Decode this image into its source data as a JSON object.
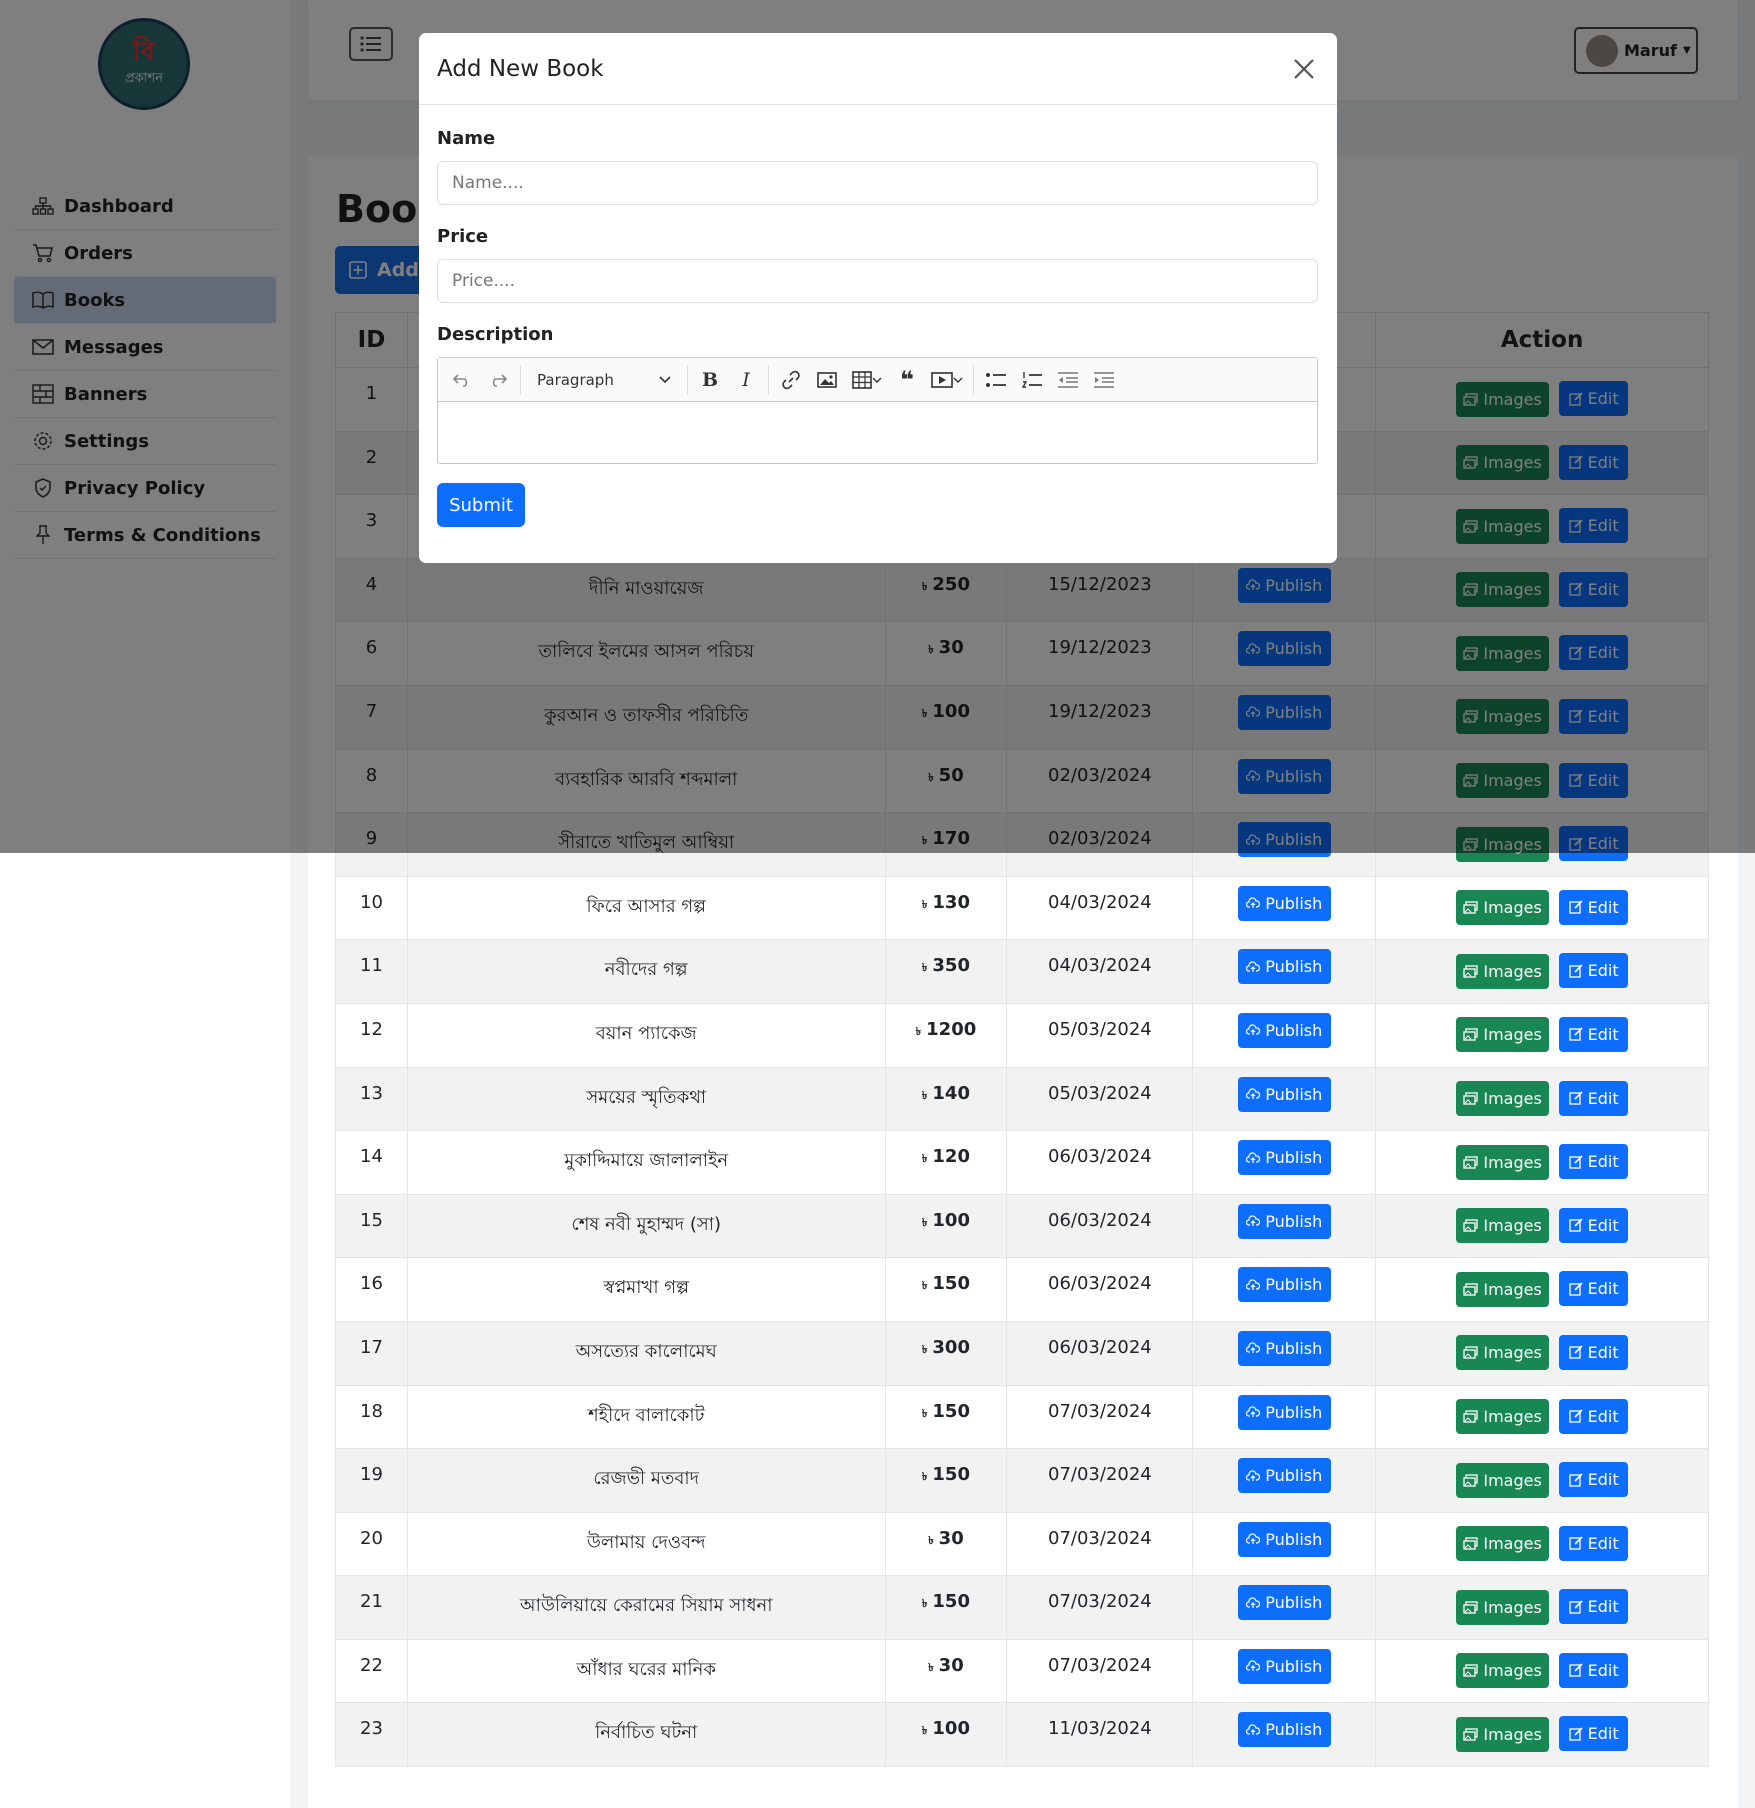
{
  "sidebar": {
    "logo_glyph": "বি",
    "logo_text": "প্রকাশন",
    "items": [
      {
        "label": "Dashboard",
        "icon": "sitemap-icon"
      },
      {
        "label": "Orders",
        "icon": "cart-icon"
      },
      {
        "label": "Books",
        "icon": "book-icon",
        "active": true
      },
      {
        "label": "Messages",
        "icon": "envelope-icon"
      },
      {
        "label": "Banners",
        "icon": "bricks-icon"
      },
      {
        "label": "Settings",
        "icon": "gear-icon"
      },
      {
        "label": "Privacy Policy",
        "icon": "shield-icon"
      },
      {
        "label": "Terms & Conditions",
        "icon": "pin-icon"
      }
    ]
  },
  "topbar": {
    "user_name": "Maruf"
  },
  "main": {
    "title": "Book",
    "add_label": "Add",
    "table": {
      "headers": [
        "ID",
        "",
        "",
        "",
        "",
        "Action"
      ],
      "rows": [
        {
          "id": "1",
          "name": "",
          "price": "",
          "date": "",
          "status": ""
        },
        {
          "id": "2",
          "name": "",
          "price": "",
          "date": "",
          "status": ""
        },
        {
          "id": "3",
          "name": "",
          "price": "",
          "date": "",
          "status": ""
        },
        {
          "id": "4",
          "name": "দীনি মাওয়ায়েজ",
          "price": "250",
          "date": "15/12/2023",
          "status": "Publish"
        },
        {
          "id": "6",
          "name": "তালিবে ইলমের আসল পরিচয়",
          "price": "30",
          "date": "19/12/2023",
          "status": "Publish"
        },
        {
          "id": "7",
          "name": "কুরআন ও তাফসীর পরিচিতি",
          "price": "100",
          "date": "19/12/2023",
          "status": "Publish"
        },
        {
          "id": "8",
          "name": "ব্যবহারিক আরবি শব্দমালা",
          "price": "50",
          "date": "02/03/2024",
          "status": "Publish"
        },
        {
          "id": "9",
          "name": "সীরাতে খাতিমুল আম্বিয়া",
          "price": "170",
          "date": "02/03/2024",
          "status": "Publish"
        },
        {
          "id": "10",
          "name": "ফিরে আসার গল্প",
          "price": "130",
          "date": "04/03/2024",
          "status": "Publish"
        },
        {
          "id": "11",
          "name": "নবীদের গল্প",
          "price": "350",
          "date": "04/03/2024",
          "status": "Publish"
        },
        {
          "id": "12",
          "name": "বয়ান প্যাকেজ",
          "price": "1200",
          "date": "05/03/2024",
          "status": "Publish"
        },
        {
          "id": "13",
          "name": "সময়ের স্মৃতিকথা",
          "price": "140",
          "date": "05/03/2024",
          "status": "Publish"
        },
        {
          "id": "14",
          "name": "মুকাদ্দিমায়ে জালালাইন",
          "price": "120",
          "date": "06/03/2024",
          "status": "Publish"
        },
        {
          "id": "15",
          "name": "শেষ নবী মুহাম্মদ (সা)",
          "price": "100",
          "date": "06/03/2024",
          "status": "Publish"
        },
        {
          "id": "16",
          "name": "স্বপ্নমাখা গল্প",
          "price": "150",
          "date": "06/03/2024",
          "status": "Publish"
        },
        {
          "id": "17",
          "name": "অসত্যের কালোমেঘ",
          "price": "300",
          "date": "06/03/2024",
          "status": "Publish"
        },
        {
          "id": "18",
          "name": "শহীদে বালাকোট",
          "price": "150",
          "date": "07/03/2024",
          "status": "Publish"
        },
        {
          "id": "19",
          "name": "রেজভী মতবাদ",
          "price": "150",
          "date": "07/03/2024",
          "status": "Publish"
        },
        {
          "id": "20",
          "name": "উলামায় দেওবন্দ",
          "price": "30",
          "date": "07/03/2024",
          "status": "Publish"
        },
        {
          "id": "21",
          "name": "আউলিয়ায়ে কেরামের সিয়াম সাধনা",
          "price": "150",
          "date": "07/03/2024",
          "status": "Publish"
        },
        {
          "id": "22",
          "name": "আঁধার ঘরের মানিক",
          "price": "30",
          "date": "07/03/2024",
          "status": "Publish"
        },
        {
          "id": "23",
          "name": "নির্বাচিত ঘটনা",
          "price": "100",
          "date": "11/03/2024",
          "status": "Publish"
        }
      ],
      "currency_symbol": "৳",
      "images_label": "Images",
      "edit_label": "Edit"
    }
  },
  "modal": {
    "title": "Add New Book",
    "name_label": "Name",
    "name_placeholder": "Name....",
    "name_value": "",
    "price_label": "Price",
    "price_placeholder": "Price....",
    "price_value": "",
    "description_label": "Description",
    "paragraph_label": "Paragraph",
    "submit_label": "Submit"
  },
  "colors": {
    "primary": "#0d6efd",
    "success": "#198754",
    "sidebar_active": "#c9d6ec"
  }
}
